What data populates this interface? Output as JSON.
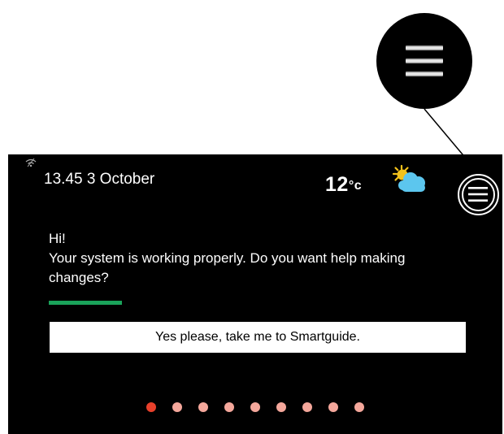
{
  "status_bar": {
    "datetime": "13.45 3 October",
    "temperature_value": "12",
    "temperature_unit": "°c",
    "weather_icon": "partly-sunny-icon",
    "signal_icon": "wifi-icon",
    "menu_icon": "hamburger-menu-icon"
  },
  "message": {
    "greeting": "Hi!",
    "body": "Your system is working properly. Do you want help making changes?",
    "progress_fraction": 1.0,
    "progress_color": "#1aa35a"
  },
  "smartguide_button": {
    "label": "Yes please, take me to Smartguide."
  },
  "pager": {
    "total_pages": 9,
    "active_page": 1,
    "active_color": "#e8402b",
    "inactive_color": "#f4a79b"
  },
  "callout": {
    "icon": "hamburger-menu-icon"
  }
}
